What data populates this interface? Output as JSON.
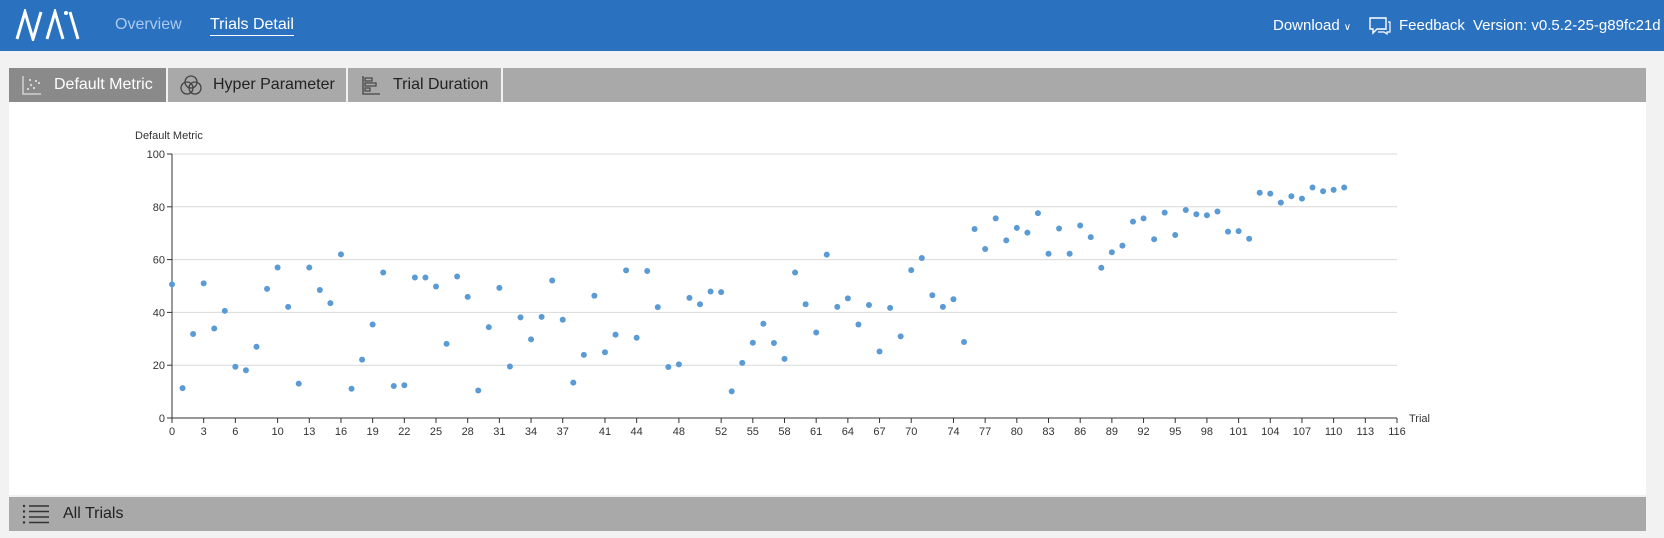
{
  "header": {
    "logo": "NNI",
    "nav": [
      {
        "label": "Overview",
        "active": false
      },
      {
        "label": "Trials Detail",
        "active": true
      }
    ],
    "download_label": "Download",
    "download_chevron": "∨",
    "feedback_label": "Feedback",
    "version_label": "Version: v0.5.2-25-g89fc21d",
    "accent_color": "#2a72c0"
  },
  "tabs": [
    {
      "label": "Default Metric",
      "icon": "scatter-chart-icon",
      "active": true
    },
    {
      "label": "Hyper Parameter",
      "icon": "parallel-coords-icon",
      "active": false
    },
    {
      "label": "Trial Duration",
      "icon": "bar-chart-icon",
      "active": false
    }
  ],
  "all_trials": {
    "label": "All Trials",
    "icon": "list-icon"
  },
  "chart_data": {
    "type": "scatter",
    "title": "",
    "ylabel": "Default Metric",
    "xlabel": "Trial",
    "ylim": [
      0,
      100
    ],
    "xlim": [
      0,
      116
    ],
    "grid": true,
    "point_color": "#5b9bd5",
    "y_ticks": [
      0,
      20,
      40,
      60,
      80,
      100
    ],
    "x_ticks": [
      0,
      3,
      6,
      10,
      13,
      16,
      19,
      22,
      25,
      28,
      31,
      34,
      37,
      41,
      44,
      48,
      52,
      55,
      58,
      61,
      64,
      67,
      70,
      74,
      77,
      80,
      83,
      86,
      89,
      92,
      95,
      98,
      101,
      104,
      107,
      110,
      113,
      116
    ],
    "points": [
      [
        0,
        50.6
      ],
      [
        1,
        11.3
      ],
      [
        2,
        31.8
      ],
      [
        3,
        51.0
      ],
      [
        4,
        33.9
      ],
      [
        5,
        40.6
      ],
      [
        6,
        19.4
      ],
      [
        7,
        18.1
      ],
      [
        8,
        27.0
      ],
      [
        9,
        48.9
      ],
      [
        10,
        57.0
      ],
      [
        11,
        42.1
      ],
      [
        12,
        13.0
      ],
      [
        13,
        57.0
      ],
      [
        14,
        48.5
      ],
      [
        15,
        43.5
      ],
      [
        16,
        62.0
      ],
      [
        17,
        11.1
      ],
      [
        18,
        22.1
      ],
      [
        19,
        35.4
      ],
      [
        20,
        55.1
      ],
      [
        21,
        12.1
      ],
      [
        22,
        12.4
      ],
      [
        23,
        53.2
      ],
      [
        24,
        53.2
      ],
      [
        25,
        49.8
      ],
      [
        26,
        28.1
      ],
      [
        27,
        53.6
      ],
      [
        28,
        45.9
      ],
      [
        29,
        10.4
      ],
      [
        30,
        34.4
      ],
      [
        31,
        49.3
      ],
      [
        32,
        19.5
      ],
      [
        33,
        38.1
      ],
      [
        34,
        29.8
      ],
      [
        35,
        38.3
      ],
      [
        36,
        52.1
      ],
      [
        37,
        37.2
      ],
      [
        38,
        13.4
      ],
      [
        39,
        23.9
      ],
      [
        40,
        46.3
      ],
      [
        41,
        24.9
      ],
      [
        42,
        31.6
      ],
      [
        43,
        55.9
      ],
      [
        44,
        30.4
      ],
      [
        45,
        55.7
      ],
      [
        46,
        42.0
      ],
      [
        47,
        19.3
      ],
      [
        48,
        20.3
      ],
      [
        49,
        45.5
      ],
      [
        50,
        43.1
      ],
      [
        51,
        47.9
      ],
      [
        52,
        47.7
      ],
      [
        53,
        10.1
      ],
      [
        54,
        20.9
      ],
      [
        55,
        28.5
      ],
      [
        56,
        35.7
      ],
      [
        57,
        28.4
      ],
      [
        58,
        22.4
      ],
      [
        59,
        55.1
      ],
      [
        60,
        43.1
      ],
      [
        61,
        32.4
      ],
      [
        62,
        61.9
      ],
      [
        63,
        42.1
      ],
      [
        64,
        45.3
      ],
      [
        65,
        35.4
      ],
      [
        66,
        42.8
      ],
      [
        67,
        25.2
      ],
      [
        68,
        41.7
      ],
      [
        69,
        30.9
      ],
      [
        70,
        56.0
      ],
      [
        71,
        60.6
      ],
      [
        72,
        46.5
      ],
      [
        73,
        42.1
      ],
      [
        74,
        45.0
      ],
      [
        75,
        28.8
      ],
      [
        76,
        71.6
      ],
      [
        77,
        64.0
      ],
      [
        78,
        75.6
      ],
      [
        79,
        67.3
      ],
      [
        80,
        72.0
      ],
      [
        81,
        70.2
      ],
      [
        82,
        77.6
      ],
      [
        83,
        62.2
      ],
      [
        84,
        71.8
      ],
      [
        85,
        62.2
      ],
      [
        86,
        72.9
      ],
      [
        87,
        68.5
      ],
      [
        88,
        56.9
      ],
      [
        89,
        62.8
      ],
      [
        90,
        65.3
      ],
      [
        91,
        74.4
      ],
      [
        92,
        75.6
      ],
      [
        93,
        67.7
      ],
      [
        94,
        77.8
      ],
      [
        95,
        69.3
      ],
      [
        96,
        78.8
      ],
      [
        97,
        77.2
      ],
      [
        98,
        76.8
      ],
      [
        99,
        78.2
      ],
      [
        100,
        70.6
      ],
      [
        101,
        70.8
      ],
      [
        102,
        67.9
      ],
      [
        103,
        85.3
      ],
      [
        104,
        85.0
      ],
      [
        105,
        81.6
      ],
      [
        106,
        84.0
      ],
      [
        107,
        83.1
      ],
      [
        108,
        87.3
      ],
      [
        109,
        85.9
      ],
      [
        110,
        86.4
      ],
      [
        111,
        87.3
      ]
    ]
  }
}
